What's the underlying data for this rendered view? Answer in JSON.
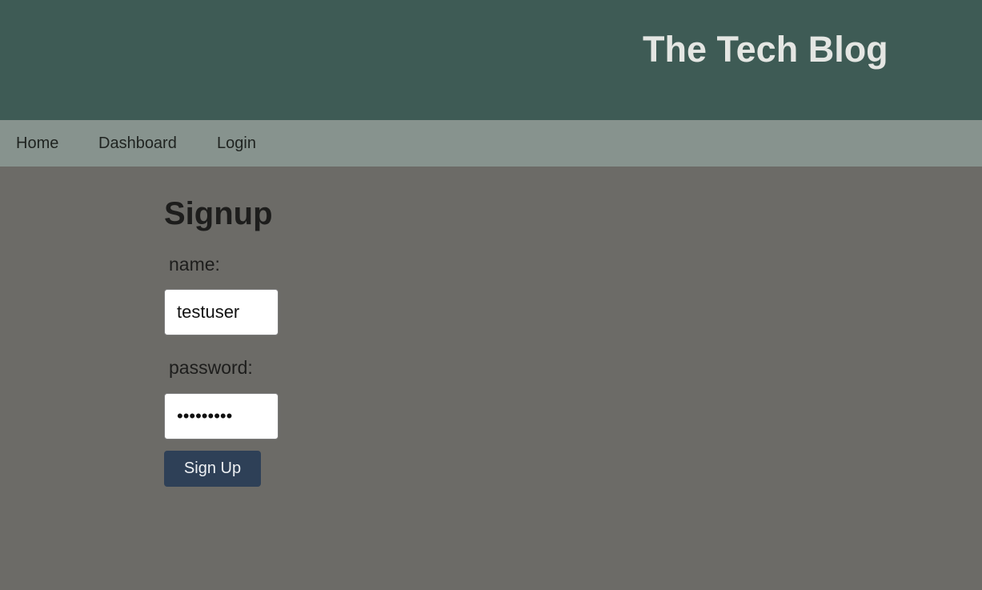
{
  "header": {
    "title": "The Tech Blog"
  },
  "nav": {
    "items": [
      {
        "label": "Home"
      },
      {
        "label": "Dashboard"
      },
      {
        "label": "Login"
      }
    ]
  },
  "signup_form": {
    "title": "Signup",
    "name_label": "name:",
    "name_value": "testuser",
    "password_label": "password:",
    "password_value": "•••••••••",
    "submit_label": "Sign Up"
  },
  "colors": {
    "header_bg": "#3e5b55",
    "nav_bg": "#87938e",
    "page_bg": "#6c6b67",
    "button_bg": "#2e4057",
    "title_text": "#e4e6e3"
  }
}
